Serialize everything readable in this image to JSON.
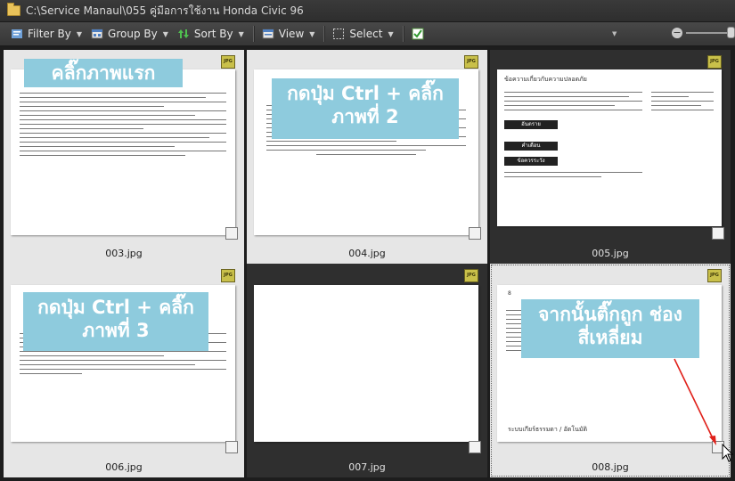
{
  "window": {
    "path": "C:\\Service Manaul\\055 คู่มือการใช้งาน Honda Civic 96"
  },
  "toolbar": {
    "filter_label": "Filter By",
    "group_label": "Group By",
    "sort_label": "Sort By",
    "view_label": "View",
    "select_label": "Select"
  },
  "thumbnails": [
    {
      "file": "003.jpg",
      "badge": "JPG",
      "callout": "คลิ๊กภาพแรก",
      "selected": true
    },
    {
      "file": "004.jpg",
      "badge": "JPG",
      "callout": "กดปุ่ม Ctrl + คลิ๊ก ภาพที่ 2",
      "selected": true
    },
    {
      "file": "005.jpg",
      "badge": "JPG",
      "selected": false
    },
    {
      "file": "006.jpg",
      "badge": "JPG",
      "callout": "กดปุ่ม Ctrl + คลิ๊ก ภาพที่ 3",
      "selected": true
    },
    {
      "file": "007.jpg",
      "badge": "JPG",
      "selected": false
    },
    {
      "file": "008.jpg",
      "badge": "JPG",
      "callout": "จากนั้นติ๊กถูก ช่องสี่เหลี่ยม",
      "selected": true
    }
  ],
  "doc005": {
    "heading": "ข้อความเกี่ยวกับความปลอดภัย",
    "warn1": "อันตราย",
    "warn2": "คำเตือน",
    "warn3": "ข้อควรระวัง"
  },
  "doc008": {
    "page_num": "8",
    "footer": "ระบบเกียร์ธรรมดา / อัตโนมัติ"
  },
  "colors": {
    "callout": "#8ecbdd",
    "selected_cell": "#e6e6e6",
    "grid_bg": "#1d1d1d",
    "arrow": "#e0201a"
  }
}
